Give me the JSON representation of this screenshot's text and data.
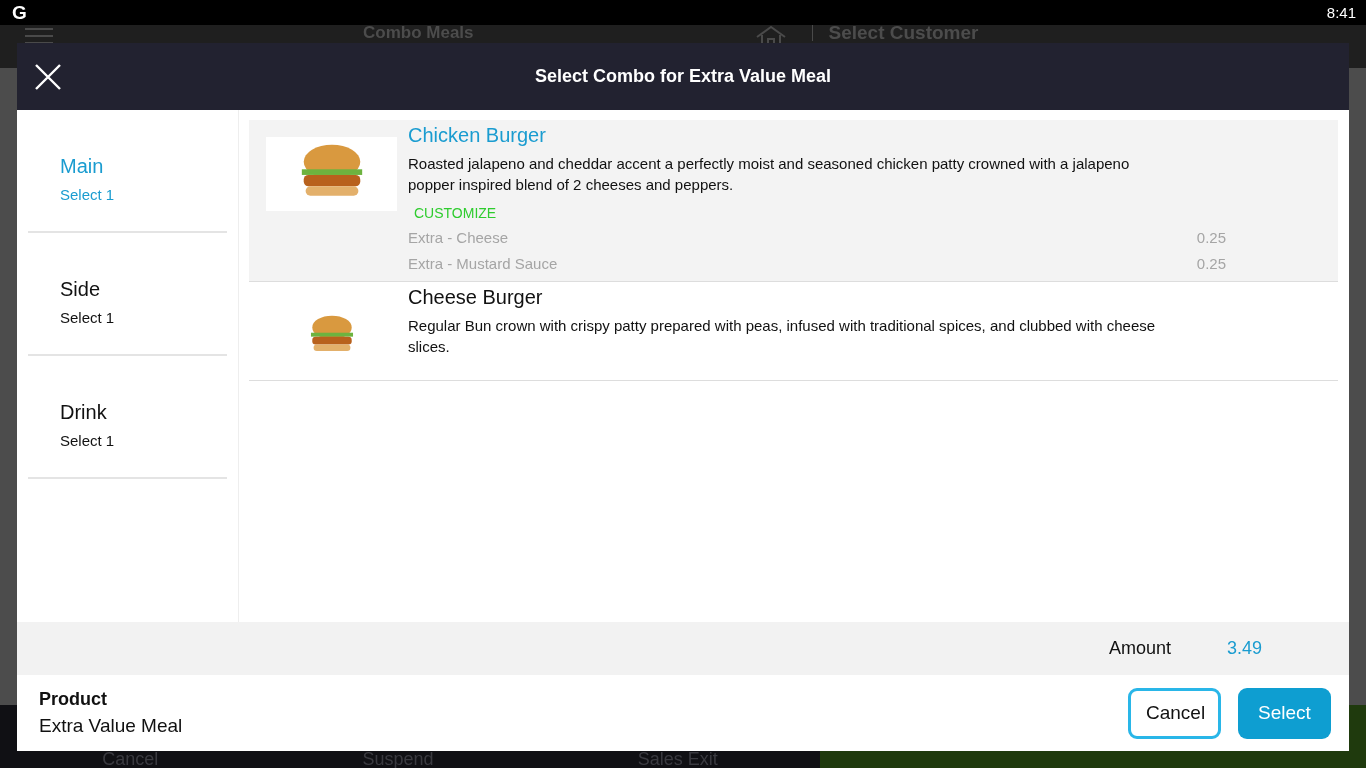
{
  "status_bar": {
    "logo": "G",
    "time": "8:41"
  },
  "background": {
    "title": "Combo Meals",
    "customer": "Select Customer",
    "bottom_buttons": [
      "Cancel",
      "Suspend",
      "Sales Exit"
    ]
  },
  "dialog": {
    "title": "Select Combo for Extra Value Meal",
    "categories": [
      {
        "name": "Main",
        "hint": "Select 1",
        "selected": true
      },
      {
        "name": "Side",
        "hint": "Select 1",
        "selected": false
      },
      {
        "name": "Drink",
        "hint": "Select 1",
        "selected": false
      }
    ],
    "items": [
      {
        "name": "Chicken Burger",
        "description": "Roasted jalapeno and cheddar accent a perfectly moist and seasoned chicken patty crowned with a jalapeno popper inspired blend of 2 cheeses and peppers.",
        "selected": true,
        "customize": "CUSTOMIZE",
        "modifiers": [
          {
            "name": "Extra - Cheese",
            "price": "0.25"
          },
          {
            "name": "Extra - Mustard Sauce",
            "price": "0.25"
          }
        ]
      },
      {
        "name": "Cheese Burger",
        "description": "Regular Bun crown with crispy patty prepared with peas, infused with traditional spices, and clubbed with cheese slices.",
        "selected": false
      }
    ],
    "amount_label": "Amount",
    "amount": "3.49",
    "product_label": "Product",
    "product_name": "Extra Value Meal",
    "buttons": [
      {
        "label": "Cancel",
        "kind": "outline"
      },
      {
        "label": "Select",
        "kind": "primary"
      }
    ]
  }
}
